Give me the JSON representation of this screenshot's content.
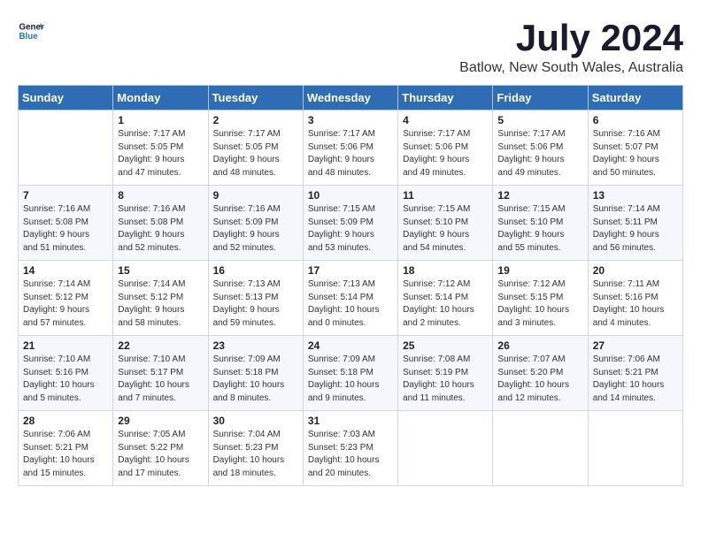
{
  "header": {
    "logo_line1": "General",
    "logo_line2": "Blue",
    "month_year": "July 2024",
    "location": "Batlow, New South Wales, Australia"
  },
  "days_of_week": [
    "Sunday",
    "Monday",
    "Tuesday",
    "Wednesday",
    "Thursday",
    "Friday",
    "Saturday"
  ],
  "weeks": [
    [
      {
        "day": "",
        "sunrise": "",
        "sunset": "",
        "daylight": ""
      },
      {
        "day": "1",
        "sunrise": "Sunrise: 7:17 AM",
        "sunset": "Sunset: 5:05 PM",
        "daylight": "Daylight: 9 hours and 47 minutes."
      },
      {
        "day": "2",
        "sunrise": "Sunrise: 7:17 AM",
        "sunset": "Sunset: 5:05 PM",
        "daylight": "Daylight: 9 hours and 48 minutes."
      },
      {
        "day": "3",
        "sunrise": "Sunrise: 7:17 AM",
        "sunset": "Sunset: 5:06 PM",
        "daylight": "Daylight: 9 hours and 48 minutes."
      },
      {
        "day": "4",
        "sunrise": "Sunrise: 7:17 AM",
        "sunset": "Sunset: 5:06 PM",
        "daylight": "Daylight: 9 hours and 49 minutes."
      },
      {
        "day": "5",
        "sunrise": "Sunrise: 7:17 AM",
        "sunset": "Sunset: 5:06 PM",
        "daylight": "Daylight: 9 hours and 49 minutes."
      },
      {
        "day": "6",
        "sunrise": "Sunrise: 7:16 AM",
        "sunset": "Sunset: 5:07 PM",
        "daylight": "Daylight: 9 hours and 50 minutes."
      }
    ],
    [
      {
        "day": "7",
        "sunrise": "Sunrise: 7:16 AM",
        "sunset": "Sunset: 5:08 PM",
        "daylight": "Daylight: 9 hours and 51 minutes."
      },
      {
        "day": "8",
        "sunrise": "Sunrise: 7:16 AM",
        "sunset": "Sunset: 5:08 PM",
        "daylight": "Daylight: 9 hours and 52 minutes."
      },
      {
        "day": "9",
        "sunrise": "Sunrise: 7:16 AM",
        "sunset": "Sunset: 5:09 PM",
        "daylight": "Daylight: 9 hours and 52 minutes."
      },
      {
        "day": "10",
        "sunrise": "Sunrise: 7:15 AM",
        "sunset": "Sunset: 5:09 PM",
        "daylight": "Daylight: 9 hours and 53 minutes."
      },
      {
        "day": "11",
        "sunrise": "Sunrise: 7:15 AM",
        "sunset": "Sunset: 5:10 PM",
        "daylight": "Daylight: 9 hours and 54 minutes."
      },
      {
        "day": "12",
        "sunrise": "Sunrise: 7:15 AM",
        "sunset": "Sunset: 5:10 PM",
        "daylight": "Daylight: 9 hours and 55 minutes."
      },
      {
        "day": "13",
        "sunrise": "Sunrise: 7:14 AM",
        "sunset": "Sunset: 5:11 PM",
        "daylight": "Daylight: 9 hours and 56 minutes."
      }
    ],
    [
      {
        "day": "14",
        "sunrise": "Sunrise: 7:14 AM",
        "sunset": "Sunset: 5:12 PM",
        "daylight": "Daylight: 9 hours and 57 minutes."
      },
      {
        "day": "15",
        "sunrise": "Sunrise: 7:14 AM",
        "sunset": "Sunset: 5:12 PM",
        "daylight": "Daylight: 9 hours and 58 minutes."
      },
      {
        "day": "16",
        "sunrise": "Sunrise: 7:13 AM",
        "sunset": "Sunset: 5:13 PM",
        "daylight": "Daylight: 9 hours and 59 minutes."
      },
      {
        "day": "17",
        "sunrise": "Sunrise: 7:13 AM",
        "sunset": "Sunset: 5:14 PM",
        "daylight": "Daylight: 10 hours and 0 minutes."
      },
      {
        "day": "18",
        "sunrise": "Sunrise: 7:12 AM",
        "sunset": "Sunset: 5:14 PM",
        "daylight": "Daylight: 10 hours and 2 minutes."
      },
      {
        "day": "19",
        "sunrise": "Sunrise: 7:12 AM",
        "sunset": "Sunset: 5:15 PM",
        "daylight": "Daylight: 10 hours and 3 minutes."
      },
      {
        "day": "20",
        "sunrise": "Sunrise: 7:11 AM",
        "sunset": "Sunset: 5:16 PM",
        "daylight": "Daylight: 10 hours and 4 minutes."
      }
    ],
    [
      {
        "day": "21",
        "sunrise": "Sunrise: 7:10 AM",
        "sunset": "Sunset: 5:16 PM",
        "daylight": "Daylight: 10 hours and 5 minutes."
      },
      {
        "day": "22",
        "sunrise": "Sunrise: 7:10 AM",
        "sunset": "Sunset: 5:17 PM",
        "daylight": "Daylight: 10 hours and 7 minutes."
      },
      {
        "day": "23",
        "sunrise": "Sunrise: 7:09 AM",
        "sunset": "Sunset: 5:18 PM",
        "daylight": "Daylight: 10 hours and 8 minutes."
      },
      {
        "day": "24",
        "sunrise": "Sunrise: 7:09 AM",
        "sunset": "Sunset: 5:18 PM",
        "daylight": "Daylight: 10 hours and 9 minutes."
      },
      {
        "day": "25",
        "sunrise": "Sunrise: 7:08 AM",
        "sunset": "Sunset: 5:19 PM",
        "daylight": "Daylight: 10 hours and 11 minutes."
      },
      {
        "day": "26",
        "sunrise": "Sunrise: 7:07 AM",
        "sunset": "Sunset: 5:20 PM",
        "daylight": "Daylight: 10 hours and 12 minutes."
      },
      {
        "day": "27",
        "sunrise": "Sunrise: 7:06 AM",
        "sunset": "Sunset: 5:21 PM",
        "daylight": "Daylight: 10 hours and 14 minutes."
      }
    ],
    [
      {
        "day": "28",
        "sunrise": "Sunrise: 7:06 AM",
        "sunset": "Sunset: 5:21 PM",
        "daylight": "Daylight: 10 hours and 15 minutes."
      },
      {
        "day": "29",
        "sunrise": "Sunrise: 7:05 AM",
        "sunset": "Sunset: 5:22 PM",
        "daylight": "Daylight: 10 hours and 17 minutes."
      },
      {
        "day": "30",
        "sunrise": "Sunrise: 7:04 AM",
        "sunset": "Sunset: 5:23 PM",
        "daylight": "Daylight: 10 hours and 18 minutes."
      },
      {
        "day": "31",
        "sunrise": "Sunrise: 7:03 AM",
        "sunset": "Sunset: 5:23 PM",
        "daylight": "Daylight: 10 hours and 20 minutes."
      },
      {
        "day": "",
        "sunrise": "",
        "sunset": "",
        "daylight": ""
      },
      {
        "day": "",
        "sunrise": "",
        "sunset": "",
        "daylight": ""
      },
      {
        "day": "",
        "sunrise": "",
        "sunset": "",
        "daylight": ""
      }
    ]
  ]
}
